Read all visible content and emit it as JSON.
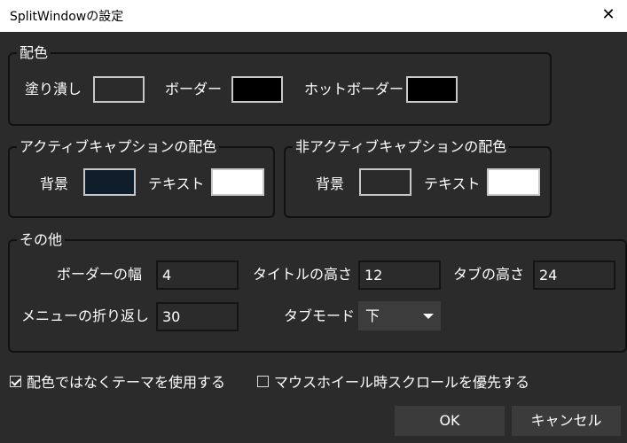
{
  "window": {
    "title": "SplitWindowの設定",
    "close_glyph": "✕"
  },
  "color_group": {
    "legend": "配色",
    "fill_label": "塗り潰し",
    "fill_color": "#2b2b2b",
    "border_label": "ボーダー",
    "border_color": "#000000",
    "hot_border_label": "ホットボーダー",
    "hot_border_color": "#000000"
  },
  "active_caption": {
    "legend": "アクティブキャプションの配色",
    "bg_label": "背景",
    "bg_color": "#0f1e2a",
    "text_label": "テキスト",
    "text_color": "#ffffff"
  },
  "inactive_caption": {
    "legend": "非アクティブキャプションの配色",
    "bg_label": "背景",
    "bg_color": "#2b2b2b",
    "text_label": "テキスト",
    "text_color": "#ffffff"
  },
  "other": {
    "legend": "その他",
    "border_width_label": "ボーダーの幅",
    "border_width_value": "4",
    "title_height_label": "タイトルの高さ",
    "title_height_value": "12",
    "tab_height_label": "タブの高さ",
    "tab_height_value": "24",
    "menu_wrap_label": "メニューの折り返し",
    "menu_wrap_value": "30",
    "tab_mode_label": "タブモード",
    "tab_mode_value": "下"
  },
  "options": {
    "use_theme_label": "配色ではなくテーマを使用する",
    "use_theme_checked": true,
    "wheel_scroll_label": "マウスホイール時スクロールを優先する",
    "wheel_scroll_checked": false
  },
  "buttons": {
    "ok": "OK",
    "cancel": "キャンセル"
  }
}
